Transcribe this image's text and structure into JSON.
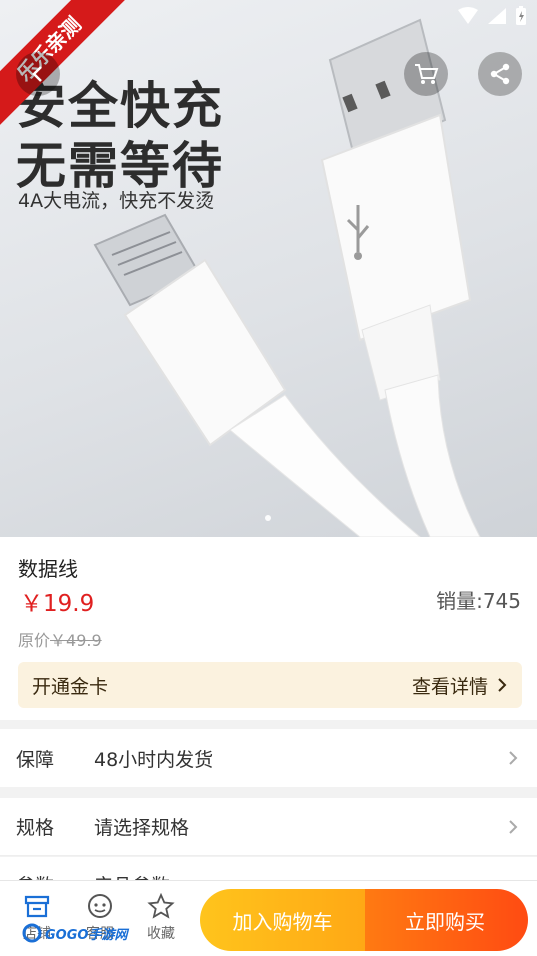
{
  "hero": {
    "badge": "乐乐亲测",
    "title_line1": "安全快充",
    "title_line2": "无需等待",
    "subtitle": "4A大电流，快充不发烫"
  },
  "product": {
    "name": "数据线",
    "price": "￥19.9",
    "sales": "销量:745",
    "original_label": "原价",
    "original_price": "￥49.9"
  },
  "gold_card": {
    "left": "开通金卡",
    "right": "查看详情"
  },
  "rows": [
    {
      "label": "保障",
      "value": "48小时内发货"
    },
    {
      "label": "规格",
      "value": "请选择规格"
    },
    {
      "label": "参数",
      "value": "产品参数"
    }
  ],
  "bottom": {
    "tab_store": "店铺",
    "tab_service": "客服",
    "tab_fav": "收藏",
    "add_cart": "加入购物车",
    "buy_now": "立即购买",
    "watermark": "GOGO手游网"
  },
  "colors": {
    "price": "#e02020",
    "ribbon": "#d51a1a",
    "add_cart": "#ffb81a",
    "buy_now": "#ff5a12",
    "gold_card_bg": "#fbf2df"
  }
}
